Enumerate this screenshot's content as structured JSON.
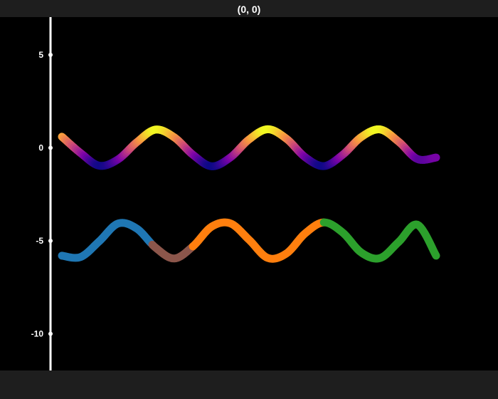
{
  "window": {
    "title": "(0, 0)"
  },
  "chart_data": {
    "type": "line",
    "title": "",
    "xlabel": "",
    "ylabel": "",
    "x_visible": false,
    "y_range": [
      -12.2,
      7.0
    ],
    "y_ticks": [
      5,
      0,
      -5,
      -10
    ],
    "y_tick_labels": [
      "5",
      "0",
      "-5",
      "-10"
    ],
    "x_range": [
      0,
      10
    ],
    "grid": false,
    "background": "#000000",
    "series": [
      {
        "kind": "gradient",
        "x": [
          0.0,
          0.5,
          1.0,
          1.5,
          2.0,
          2.5,
          3.0,
          3.5,
          4.0,
          4.5,
          5.0,
          5.5,
          6.0,
          6.5,
          7.0,
          7.5,
          8.0,
          8.5,
          9.0,
          9.5,
          10.0
        ],
        "y": [
          0.6,
          -0.28,
          -0.96,
          -0.62,
          0.3,
          0.98,
          0.57,
          -0.37,
          -0.99,
          -0.52,
          0.45,
          1.0,
          0.49,
          -0.5,
          -0.98,
          -0.38,
          0.58,
          0.99,
          0.33,
          -0.6,
          -0.52
        ],
        "colormap": [
          "#0d0887",
          "#7e03a8",
          "#cc4778",
          "#f89540",
          "#f0f921"
        ]
      },
      {
        "kind": "segmented",
        "x": [
          0.0,
          0.5,
          1.0,
          1.5,
          2.0,
          2.5,
          3.0,
          3.5,
          4.0,
          4.5,
          5.0,
          5.5,
          6.0,
          6.5,
          7.0,
          7.5,
          8.0,
          8.5,
          9.0,
          9.5,
          10.0
        ],
        "y": [
          -5.8,
          -5.87,
          -5.02,
          -4.07,
          -4.34,
          -5.36,
          -5.95,
          -5.3,
          -4.24,
          -4.06,
          -4.94,
          -5.92,
          -5.68,
          -4.6,
          -4.01,
          -4.55,
          -5.63,
          -5.93,
          -5.06,
          -4.13,
          -5.8
        ],
        "segments": [
          {
            "from_x": 0.0,
            "to_x": 2.4,
            "color": "#1f77b4"
          },
          {
            "from_x": 2.4,
            "to_x": 3.5,
            "color": "#8c564b"
          },
          {
            "from_x": 3.5,
            "to_x": 7.0,
            "color": "#ff7f0e"
          },
          {
            "from_x": 7.0,
            "to_x": 10.0,
            "color": "#2ca02c"
          }
        ]
      }
    ]
  }
}
